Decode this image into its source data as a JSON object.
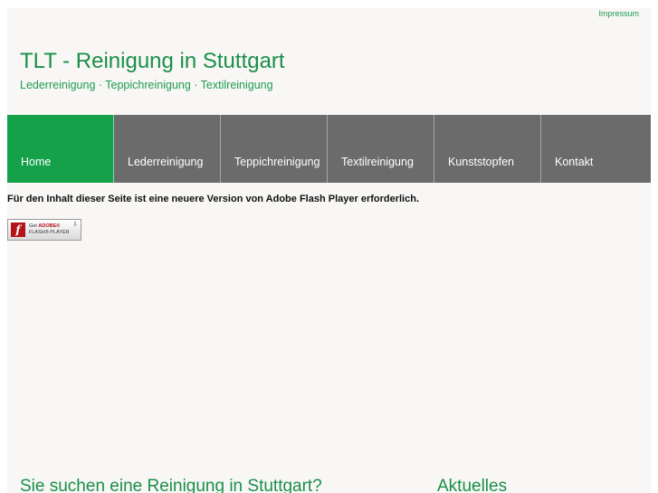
{
  "header": {
    "impressum_label": "Impressum",
    "title": "TLT - Reinigung in Stuttgart",
    "tagline": "Lederreinigung · Teppichreinigung · Textilreinigung"
  },
  "nav": {
    "items": [
      {
        "label": "Home",
        "active": true
      },
      {
        "label": "Lederreinigung"
      },
      {
        "label": "Teppichreinigung"
      },
      {
        "label": "Textilreinigung"
      },
      {
        "label": "Kunststopfen"
      },
      {
        "label": "Kontakt"
      }
    ]
  },
  "flash": {
    "message": "Für den Inhalt dieser Seite ist eine neuere Version von Adobe Flash Player erforderlich.",
    "badge_get": "Get ",
    "badge_adobe": "ADOBE®",
    "badge_player": "FLASH® PLAYER",
    "logo_letter": "f"
  },
  "sections": {
    "left_heading": "Sie suchen eine Reinigung in Stuttgart?",
    "right_heading": "Aktuelles"
  },
  "colors": {
    "accent_green": "#14a14a",
    "nav_gray": "#6b6b6b",
    "page_bg": "#f8f7f5"
  }
}
